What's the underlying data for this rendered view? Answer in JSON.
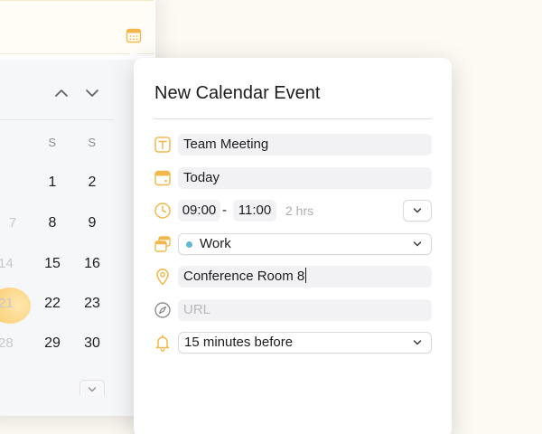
{
  "calendar": {
    "weekday_headers": [
      "S",
      "S"
    ],
    "weeks": [
      {
        "faded": "",
        "sat": "1",
        "sun": "2"
      },
      {
        "faded": "7",
        "sat": "8",
        "sun": "9"
      },
      {
        "faded": "14",
        "sat": "15",
        "sun": "16"
      },
      {
        "faded": "21",
        "sat": "22",
        "sun": "23"
      },
      {
        "faded": "28",
        "sat": "29",
        "sun": "30"
      }
    ]
  },
  "event": {
    "heading": "New Calendar Event",
    "title_value": "Team Meeting",
    "date_value": "Today",
    "start_time": "09:00",
    "time_separator": "-",
    "end_time": "11:00",
    "duration": "2 hrs",
    "calendar_name": "Work",
    "calendar_color": "#5fb8d8",
    "location_value": "Conference Room 8",
    "url_placeholder": "URL",
    "alert_value": "15 minutes before"
  },
  "icons": {
    "title": "text-t-icon",
    "date": "calendar-icon",
    "time": "clock-icon",
    "calendar": "calendar-stack-icon",
    "location": "location-pin-icon",
    "url": "compass-icon",
    "alert": "bell-icon"
  },
  "colors": {
    "accent": "#f2b84b",
    "today_highlight": "#f7c96a"
  }
}
